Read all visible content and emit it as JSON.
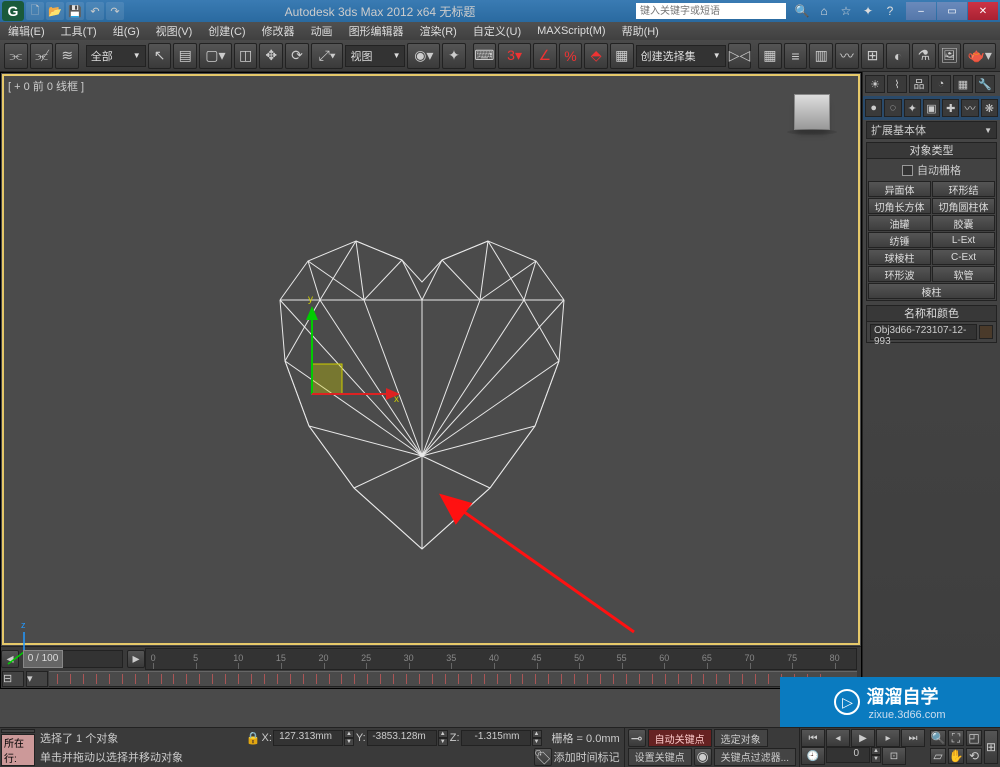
{
  "title": {
    "app_logo": "G",
    "text": "Autodesk 3ds Max 2012 x64    无标题",
    "search_placeholder": "键入关键字或短语"
  },
  "menubar": [
    "编辑(E)",
    "工具(T)",
    "组(G)",
    "视图(V)",
    "创建(C)",
    "修改器",
    "动画",
    "图形编辑器",
    "渲染(R)",
    "自定义(U)",
    "MAXScript(M)",
    "帮助(H)"
  ],
  "maintb": {
    "combo_all": "全部",
    "combo_view": "视图",
    "combo_selset": "创建选择集"
  },
  "viewport": {
    "label": "[ + 0 前 0 线框 ]"
  },
  "cmdpanel": {
    "dropdown": "扩展基本体",
    "rollout1_title": "对象类型",
    "autogrid": "自动栅格",
    "buttons": [
      [
        "异面体",
        "环形结"
      ],
      [
        "切角长方体",
        "切角圆柱体"
      ],
      [
        "油罐",
        "胶囊"
      ],
      [
        "纺锤",
        "L-Ext"
      ],
      [
        "球棱柱",
        "C-Ext"
      ],
      [
        "环形波",
        "软管"
      ]
    ],
    "button_full": "棱柱",
    "rollout2_title": "名称和颜色",
    "obj_name": "Obj3d66-723107-12-993"
  },
  "timeline": {
    "pos_label": "0 / 100",
    "ticks": [
      "0",
      "5",
      "10",
      "15",
      "20",
      "25",
      "30",
      "35",
      "40",
      "45",
      "50",
      "55",
      "60",
      "65",
      "70",
      "75",
      "80"
    ]
  },
  "status": {
    "sel": "选择了 1 个对象",
    "hint": "单击并拖动以选择并移动对象",
    "current_label": "所在行:",
    "add_time_tag": "添加时间标记",
    "coords": {
      "x_lbl": "X:",
      "x": "127.313mm",
      "y_lbl": "Y:",
      "y": "-3853.128m",
      "z_lbl": "Z:",
      "z": "-1.315mm"
    },
    "grid": "栅格 = 0.0mm",
    "autokey": "自动关键点",
    "selset": "选定对象",
    "setkey": "设置关键点",
    "keyfilter": "关键点过滤器..."
  },
  "watermark": {
    "brand": "溜溜自学",
    "sub": "zixue.3d66.com"
  }
}
